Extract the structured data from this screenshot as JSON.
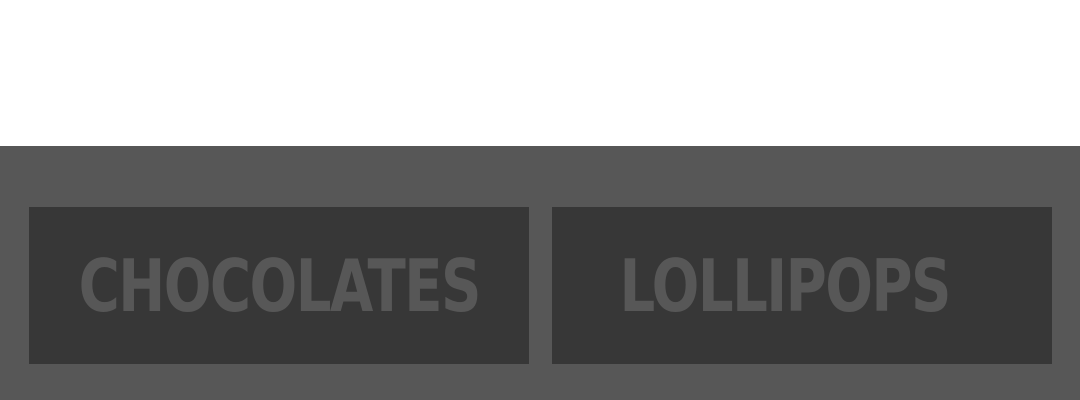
{
  "categories": {
    "items": [
      {
        "label": "CHOCOLATES"
      },
      {
        "label": "LOLLIPOPS"
      }
    ]
  },
  "colors": {
    "background_top": "#ffffff",
    "band": "#575757",
    "tile": "#373737",
    "tile_text": "#575757"
  }
}
